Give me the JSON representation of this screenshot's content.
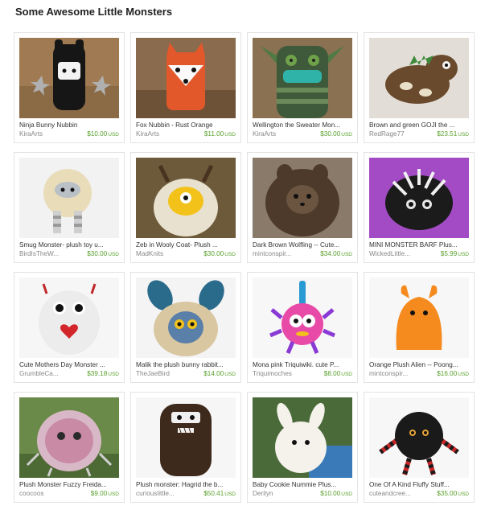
{
  "page": {
    "title": "Some Awesome Little Monsters"
  },
  "items": [
    {
      "name": "Ninja Bunny Nubbin",
      "shop": "KiraArts",
      "price": "$10.00",
      "currency": "USD",
      "icon": "ninja-bunny-photo"
    },
    {
      "name": "Fox Nubbin - Rust Orange",
      "shop": "KiraArts",
      "price": "$11.00",
      "currency": "USD",
      "icon": "fox-plush-photo"
    },
    {
      "name": "Wellington the Sweater Mon...",
      "shop": "KiraArts",
      "price": "$30.00",
      "currency": "USD",
      "icon": "sweater-monster-photo"
    },
    {
      "name": "Brown and green GOJI the ...",
      "shop": "RedRage77",
      "price": "$23.51",
      "currency": "USD",
      "icon": "goji-dino-photo"
    },
    {
      "name": "Smug Monster- plush toy u...",
      "shop": "BirdIsTheW...",
      "price": "$30.00",
      "currency": "USD",
      "icon": "smug-monster-photo"
    },
    {
      "name": "Zeb in Wooly Coat- Plush ...",
      "shop": "MadKnits",
      "price": "$30.00",
      "currency": "USD",
      "icon": "zeb-monster-photo"
    },
    {
      "name": "Dark Brown Wolfling -- Cute...",
      "shop": "mintconspir...",
      "price": "$34.00",
      "currency": "USD",
      "icon": "wolfling-photo"
    },
    {
      "name": "MINI MONSTER BARF Plus...",
      "shop": "WickedLittle...",
      "price": "$5.99",
      "currency": "USD",
      "icon": "barf-monster-photo"
    },
    {
      "name": "Cute Mothers Day Monster ...",
      "shop": "GrumbleCa...",
      "price": "$39.18",
      "currency": "USD",
      "icon": "mothers-day-monster-photo"
    },
    {
      "name": "Malik the plush bunny rabbit...",
      "shop": "TheJaeBird",
      "price": "$14.00",
      "currency": "USD",
      "icon": "malik-bunny-photo"
    },
    {
      "name": "Mona pink Triquiwiki. cute P...",
      "shop": "Triquimoches",
      "price": "$8.00",
      "currency": "USD",
      "icon": "triquiwiki-photo"
    },
    {
      "name": "Orange Plush Alien -- Poong...",
      "shop": "mintconspir...",
      "price": "$16.00",
      "currency": "USD",
      "icon": "orange-alien-photo"
    },
    {
      "name": "Plush Monster Fuzzy Freida...",
      "shop": "coocoos",
      "price": "$9.00",
      "currency": "USD",
      "icon": "fuzzy-freida-photo"
    },
    {
      "name": "Plush monster: Hagrid the b...",
      "shop": "curiouslittle...",
      "price": "$50.41",
      "currency": "USD",
      "icon": "hagrid-monster-photo"
    },
    {
      "name": "Baby Cookie Nummie Plus...",
      "shop": "Derilyn",
      "price": "$10.00",
      "currency": "USD",
      "icon": "cookie-nummie-photo"
    },
    {
      "name": "One Of A Kind Fluffy Stuff...",
      "shop": "cuteandcree...",
      "price": "$35.00",
      "currency": "USD",
      "icon": "fluffy-stuff-photo"
    }
  ]
}
